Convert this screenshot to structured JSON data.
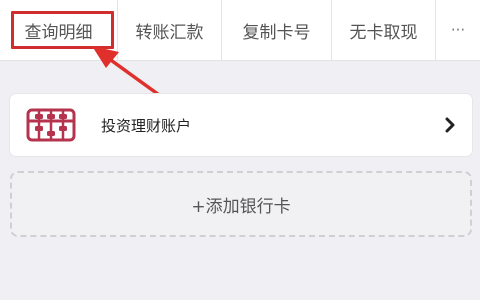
{
  "action_bar": {
    "items": [
      {
        "label": "查询明细",
        "highlighted": true
      },
      {
        "label": "转账汇款"
      },
      {
        "label": "复制卡号"
      },
      {
        "label": "无卡取现"
      }
    ],
    "more_label": "···"
  },
  "account": {
    "label": "投资理财账户",
    "icon": "abacus-icon"
  },
  "add_card": {
    "label": "+添加银行卡"
  },
  "colors": {
    "highlight": "#d22d2d",
    "icon_accent": "#b5334d"
  }
}
